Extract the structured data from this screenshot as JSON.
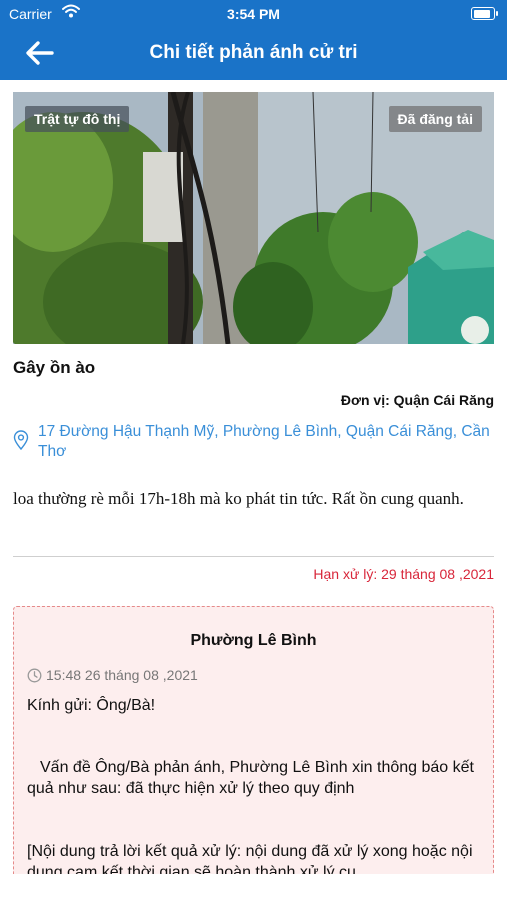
{
  "status_bar": {
    "carrier": "Carrier",
    "time": "3:54 PM",
    "battery_level": 1.0
  },
  "header": {
    "title": "Chi tiết phản ánh cử tri"
  },
  "report": {
    "category_tag": "Trật tự đô thị",
    "status_tag": "Đã đăng tải",
    "title": "Gây ồn ào",
    "unit": "Đơn vị: Quận Cái Răng",
    "address": "17 Đường Hậu Thạnh Mỹ, Phường Lê Bình, Quận Cái Răng, Cần Thơ",
    "description": "loa thường rè mỗi 17h-18h mà ko phát tin tức. Rất ồn cung quanh.",
    "deadline": "Hạn xử lý: 29 tháng 08 ,2021"
  },
  "reply": {
    "organization": "Phường Lê Bình",
    "timestamp": "15:48 26 tháng 08 ,2021",
    "greeting": "Kính gửi: Ông/Bà!",
    "paragraph1": "Vấn đề Ông/Bà phản ánh, Phường Lê Bình xin thông báo kết quả như sau: đã thực hiện xử lý theo quy định",
    "paragraph2": "[Nội dung trả lời kết quả xử lý: nội dung đã xử lý xong hoặc nội dung cam kết thời gian sẽ hoàn thành xử lý cụ"
  },
  "colors": {
    "primary": "#1a73c8",
    "link": "#3a8fd8",
    "deadline": "#d8263a",
    "reply_border": "#e58a8a",
    "reply_bg": "#fdeeee"
  },
  "icons": {
    "back": "arrow-left-icon",
    "location": "location-pin-icon",
    "clock": "clock-icon",
    "wifi": "wifi-icon",
    "battery": "battery-icon"
  }
}
